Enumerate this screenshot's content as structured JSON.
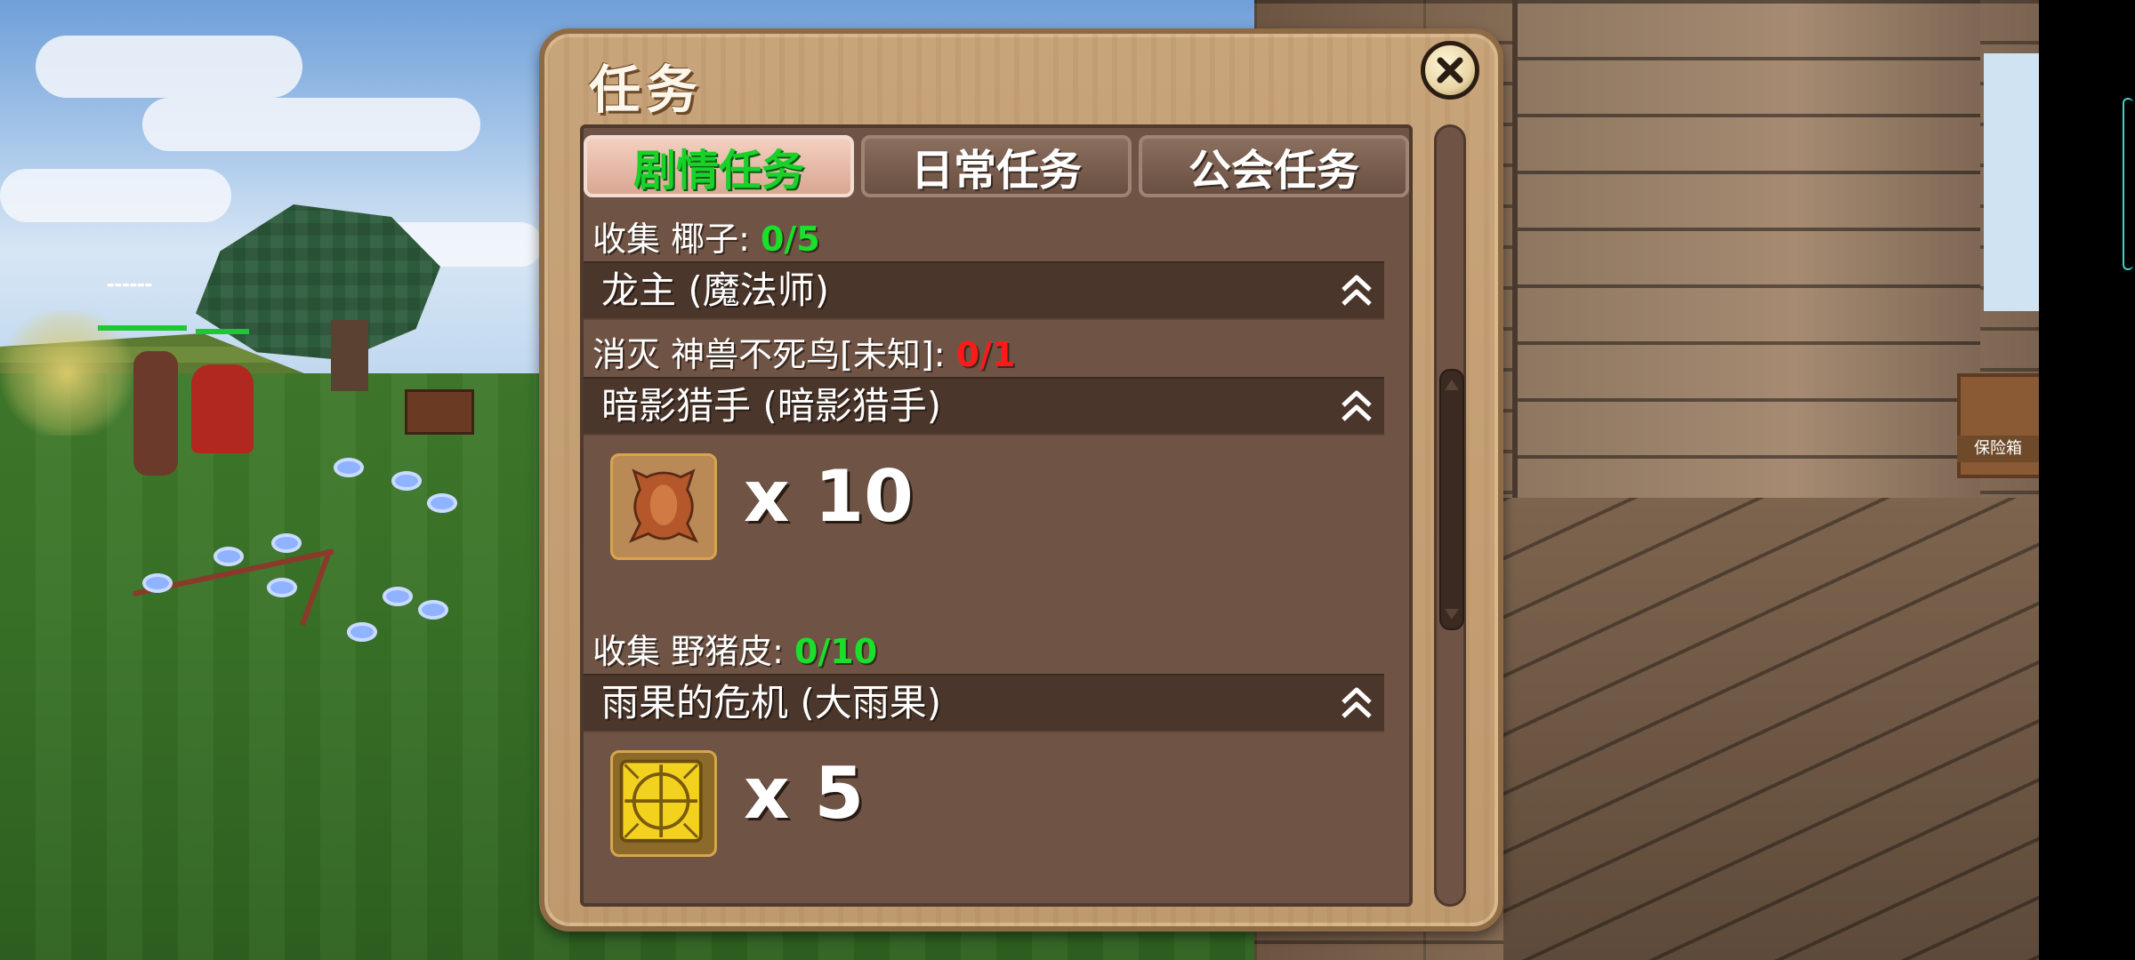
{
  "dialog": {
    "title": "任务",
    "close_icon": "close-icon"
  },
  "tabs": [
    {
      "label": "剧情任务",
      "active": true
    },
    {
      "label": "日常任务",
      "active": false
    },
    {
      "label": "公会任务",
      "active": false
    }
  ],
  "quests": [
    {
      "requirement_text": "收集 椰子: ",
      "progress": "0/5",
      "progress_color": "#19e02a",
      "name": "龙主 (魔法师)"
    },
    {
      "requirement_text": "消灭 神兽不死鸟[未知]: ",
      "progress": "0/1",
      "progress_color": "#ff1a1a",
      "name": "暗影猎手 (暗影猎手)",
      "reward": {
        "icon": "animal-hide-icon",
        "count": "x 10"
      }
    },
    {
      "requirement_text": "收集 野猪皮: ",
      "progress": "0/10",
      "progress_color": "#19e02a",
      "name": "雨果的危机 (大雨果)",
      "reward": {
        "icon": "gold-tile-icon",
        "count": "x 5"
      }
    }
  ],
  "scene": {
    "chest_label": "保险箱"
  },
  "colors": {
    "active_tab_text": "#18d22a",
    "panel_bg": "#6f5446",
    "frame": "#c8a47a"
  }
}
